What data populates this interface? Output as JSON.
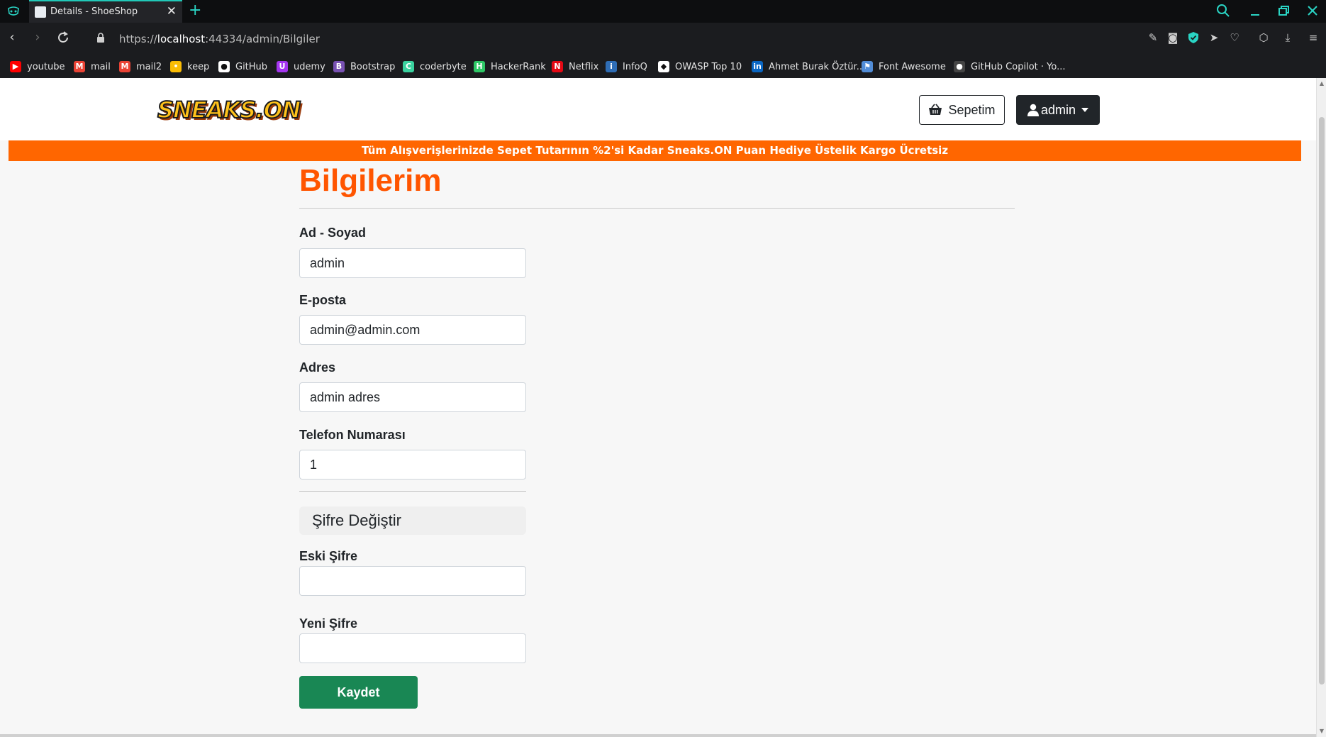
{
  "browser": {
    "tab_title": "Details - ShoeShop",
    "tab_close": "✕",
    "new_tab": "+",
    "url_scheme": "https://",
    "url_host": "localhost",
    "url_path": ":44334/admin/Bilgiler",
    "accent_color": "#2ad4c4",
    "bookmarks": [
      {
        "label": "youtube",
        "icon": "youtube-icon",
        "color": "#ff0000"
      },
      {
        "label": "mail",
        "icon": "gmail-icon",
        "color": "#ea4335"
      },
      {
        "label": "mail2",
        "icon": "gmail-icon",
        "color": "#ea4335"
      },
      {
        "label": "keep",
        "icon": "keep-icon",
        "color": "#fbbc04"
      },
      {
        "label": "GitHub",
        "icon": "github-icon",
        "color": "#ffffff"
      },
      {
        "label": "udemy",
        "icon": "udemy-icon",
        "color": "#a435f0"
      },
      {
        "label": "Bootstrap",
        "icon": "bootstrap-icon",
        "color": "#7952b3"
      },
      {
        "label": "coderbyte",
        "icon": "coderbyte-icon",
        "color": "#3ad29f"
      },
      {
        "label": "HackerRank",
        "icon": "hackerrank-icon",
        "color": "#2ec866"
      },
      {
        "label": "Netflix",
        "icon": "netflix-icon",
        "color": "#e50914"
      },
      {
        "label": "InfoQ",
        "icon": "infoq-icon",
        "color": "#2f6db5"
      },
      {
        "label": "OWASP Top 10",
        "icon": "owasp-icon",
        "color": "#ffffff"
      },
      {
        "label": "Ahmet Burak Öztür...",
        "icon": "linkedin-icon",
        "color": "#0a66c2"
      },
      {
        "label": "Font Awesome",
        "icon": "flag-icon",
        "color": "#528dd7"
      },
      {
        "label": "GitHub Copilot · Yo...",
        "icon": "github-icon",
        "color": "#444444"
      }
    ]
  },
  "site": {
    "logo_text": "SNEAKS.ON",
    "basket_label": "Sepetim",
    "user_label": "admin",
    "banner": "Tüm Alışverişlerinizde Sepet Tutarının %2'si Kadar Sneaks.ON Puan Hediye Üstelik Kargo Ücretsiz",
    "banner_color": "#ff6600",
    "title_color": "#ff5500",
    "save_color": "#198754"
  },
  "form": {
    "title": "Bilgilerim",
    "name_label": "Ad - Soyad",
    "name_value": "admin",
    "email_label": "E-posta",
    "email_value": "admin@admin.com",
    "address_label": "Adres",
    "address_value": "admin adres",
    "phone_label": "Telefon Numarası",
    "phone_value": "1",
    "password_section": "Şifre Değiştir",
    "old_password_label": "Eski Şifre",
    "old_password_value": "",
    "new_password_label": "Yeni Şifre",
    "new_password_value": "",
    "save_label": "Kaydet"
  }
}
